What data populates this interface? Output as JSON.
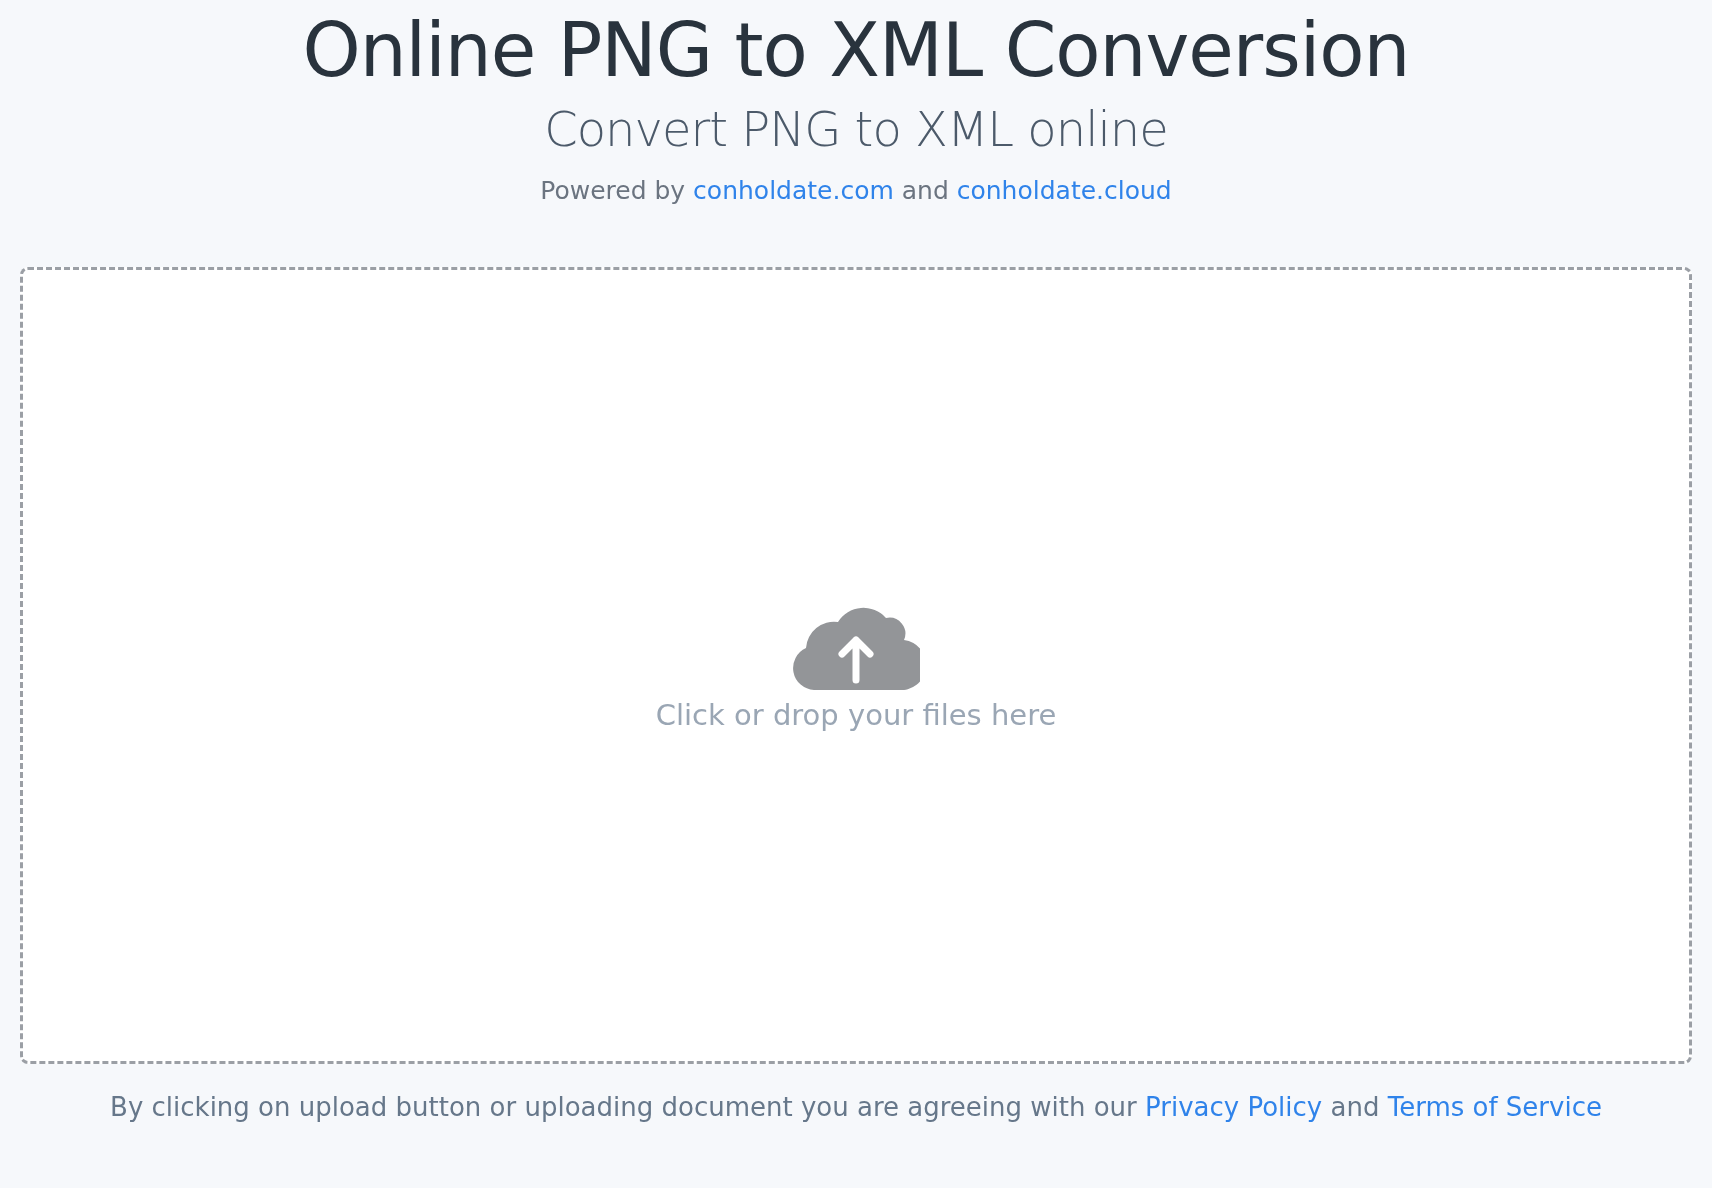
{
  "title": "Online PNG to XML Conversion",
  "subtitle": "Convert PNG to XML online",
  "powered_by": [
    {
      "kind": "text",
      "text": "Powered by "
    },
    {
      "kind": "link",
      "text": "conholdate.com"
    },
    {
      "kind": "text",
      "text": " and "
    },
    {
      "kind": "link",
      "text": "conholdate.cloud"
    }
  ],
  "dropzone": {
    "label": "Click or drop your files here"
  },
  "agreement": [
    {
      "kind": "text",
      "text": "By clicking on upload button or uploading document you are agreeing with our "
    },
    {
      "kind": "link",
      "text": "Privacy Policy"
    },
    {
      "kind": "text",
      "text": " and "
    },
    {
      "kind": "link",
      "text": "Terms of Service"
    }
  ]
}
